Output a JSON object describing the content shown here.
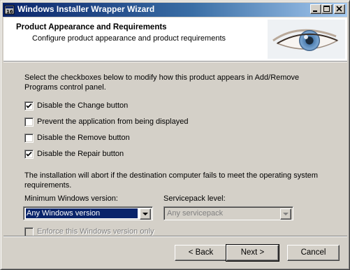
{
  "window": {
    "title": "Windows Installer Wrapper Wizard",
    "accent": "#0a246a"
  },
  "header": {
    "title": "Product Appearance and Requirements",
    "subtitle": "Configure product appearance and product requirements",
    "image": "eye-icon"
  },
  "intro": "Select the checkboxes below to modify how this product appears in Add/Remove Programs control panel.",
  "options": [
    {
      "label": "Disable the Change button",
      "checked": true
    },
    {
      "label": "Prevent the application from being displayed",
      "checked": false
    },
    {
      "label": "Disable the Remove button",
      "checked": false
    },
    {
      "label": "Disable the Repair button",
      "checked": true
    }
  ],
  "requirements": {
    "text": "The installation will abort if the destination computer fails to meet the operating system requirements.",
    "min_windows_label": "Minimum Windows version:",
    "min_windows_value": "Any Windows version",
    "servicepack_label": "Servicepack level:",
    "servicepack_value": "Any servicepack",
    "enforce_label": "Enforce this Windows version only",
    "enforce_checked": false
  },
  "buttons": {
    "back": "< Back",
    "next": "Next >",
    "cancel": "Cancel"
  }
}
